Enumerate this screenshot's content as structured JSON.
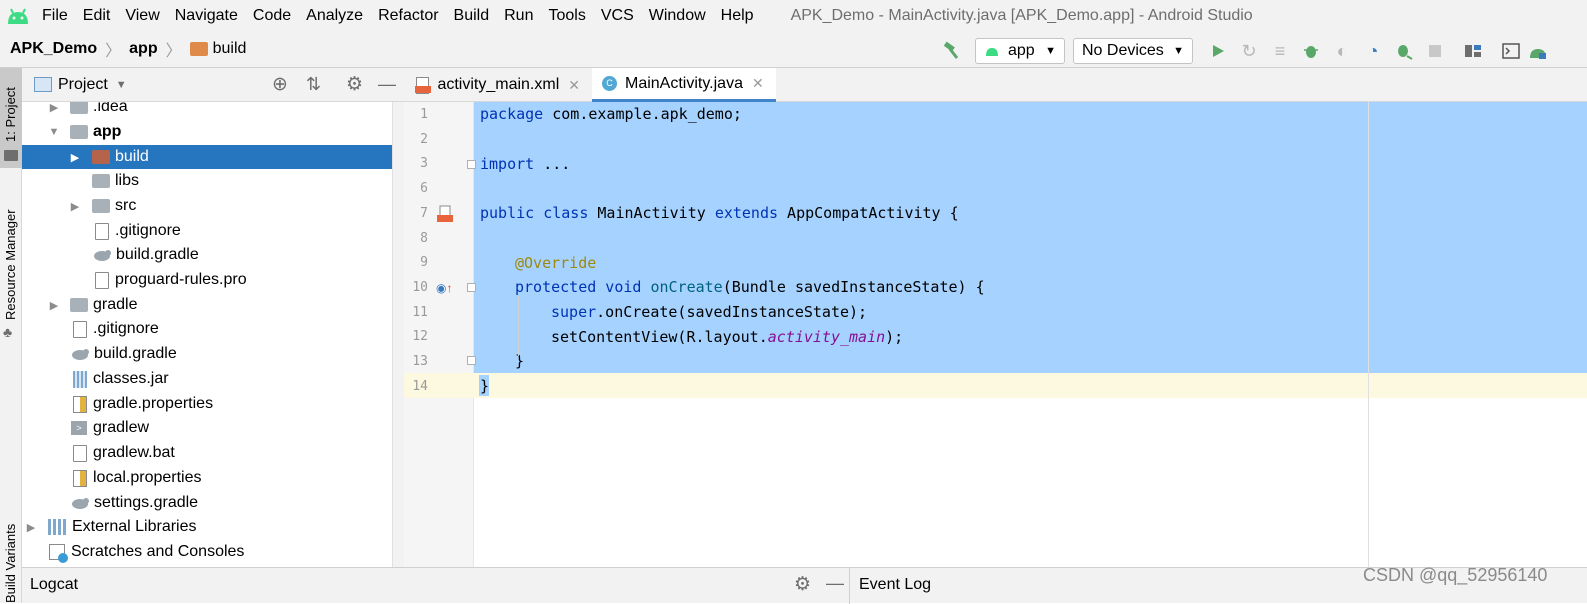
{
  "window": {
    "title": "APK_Demo - MainActivity.java [APK_Demo.app] - Android Studio"
  },
  "menu": {
    "items": [
      "File",
      "Edit",
      "View",
      "Navigate",
      "Code",
      "Analyze",
      "Refactor",
      "Build",
      "Run",
      "Tools",
      "VCS",
      "Window",
      "Help"
    ]
  },
  "breadcrumb": {
    "project": "APK_Demo",
    "module": "app",
    "folder": "build"
  },
  "toolbar": {
    "run_config": "app",
    "device": "No Devices"
  },
  "side_tools": {
    "project": "1: Project",
    "resource_manager": "Resource Manager",
    "build_variants": "Build Variants"
  },
  "project_panel": {
    "title": "Project",
    "tree": [
      {
        "label": ".idea"
      },
      {
        "label": "app"
      },
      {
        "label": "build"
      },
      {
        "label": "libs"
      },
      {
        "label": "src"
      },
      {
        "label": ".gitignore"
      },
      {
        "label": "build.gradle"
      },
      {
        "label": "proguard-rules.pro"
      },
      {
        "label": "gradle"
      },
      {
        "label": ".gitignore"
      },
      {
        "label": "build.gradle"
      },
      {
        "label": "classes.jar"
      },
      {
        "label": "gradle.properties"
      },
      {
        "label": "gradlew"
      },
      {
        "label": "gradlew.bat"
      },
      {
        "label": "local.properties"
      },
      {
        "label": "settings.gradle"
      },
      {
        "label": "External Libraries"
      },
      {
        "label": "Scratches and Consoles"
      }
    ]
  },
  "editor": {
    "tabs": [
      {
        "label": "activity_main.xml"
      },
      {
        "label": "MainActivity.java"
      }
    ],
    "line_numbers": [
      "1",
      "2",
      "3",
      "6",
      "7",
      "8",
      "9",
      "10",
      "11",
      "12",
      "13",
      "14"
    ],
    "code": {
      "l1_kw": "package",
      "l1_rest": " com.example.apk_demo;",
      "l3_kw": "import",
      "l3_rest": " ...",
      "l7_kw1": "public class",
      "l7_name": " MainActivity ",
      "l7_kw2": "extends",
      "l7_rest": " AppCompatActivity {",
      "l9_ann": "@Override",
      "l10_kw": "protected void",
      "l10_fn": "onCreate",
      "l10_rest": "(Bundle savedInstanceState) {",
      "l11_kw": "super",
      "l11_rest": ".onCreate(savedInstanceState);",
      "l12_pre": "setContentView(R.layout.",
      "l12_it": "activity_main",
      "l12_post": ");",
      "l13": "}",
      "l14": "}"
    }
  },
  "bottom": {
    "logcat": "Logcat",
    "event_log": "Event Log",
    "watermark": "CSDN @qq_52956140"
  }
}
